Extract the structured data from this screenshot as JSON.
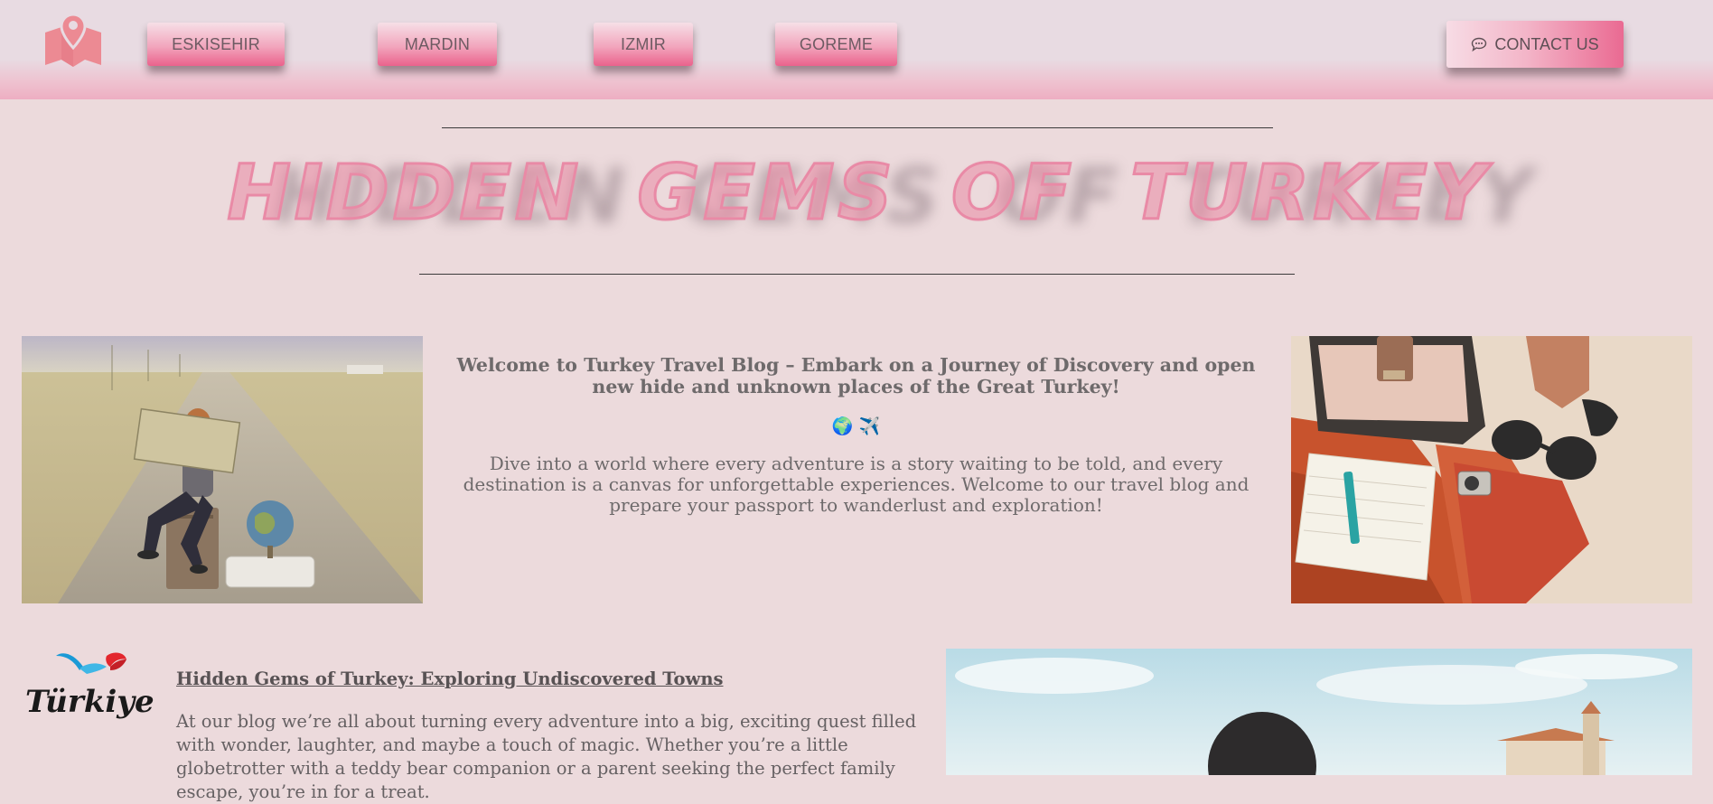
{
  "header": {
    "logo_icon": "map-pin-icon",
    "nav": [
      {
        "label": "ESKISEHIR"
      },
      {
        "label": "MARDIN"
      },
      {
        "label": "IZMIR"
      },
      {
        "label": "GOREME"
      }
    ],
    "contact": {
      "label": "CONTACT US",
      "icon": "chat-bubble-icon"
    }
  },
  "hero": {
    "title": "HIDDEN GEMS OF TURKEY"
  },
  "intro": {
    "heading": "Welcome to Turkey Travel Blog – Embark on a Journey of Discovery and open new hide and unknown places of the Great Turkey!",
    "emoji": "🌍 ✈️",
    "paragraph": "Dive into a world where every adventure is a story waiting to be told, and every destination is a canvas for unforgettable experiences. Welcome to our travel blog and prepare your passport to wanderlust and exploration!"
  },
  "blog": {
    "logo_text": "Türkiye",
    "heading": "Hidden Gems of Turkey: Exploring Undiscovered Towns",
    "paragraph": "At our blog  we’re all about turning every adventure into a big, exciting quest filled with wonder, laughter, and maybe a touch of magic. Whether you’re a little globetrotter with a teddy bear companion or a parent seeking the perfect family escape, you’re in for a treat."
  },
  "colors": {
    "page_bg": "#ecdadc",
    "accent_pink": "#ea628c",
    "logo_pink": "#ec8a93"
  }
}
